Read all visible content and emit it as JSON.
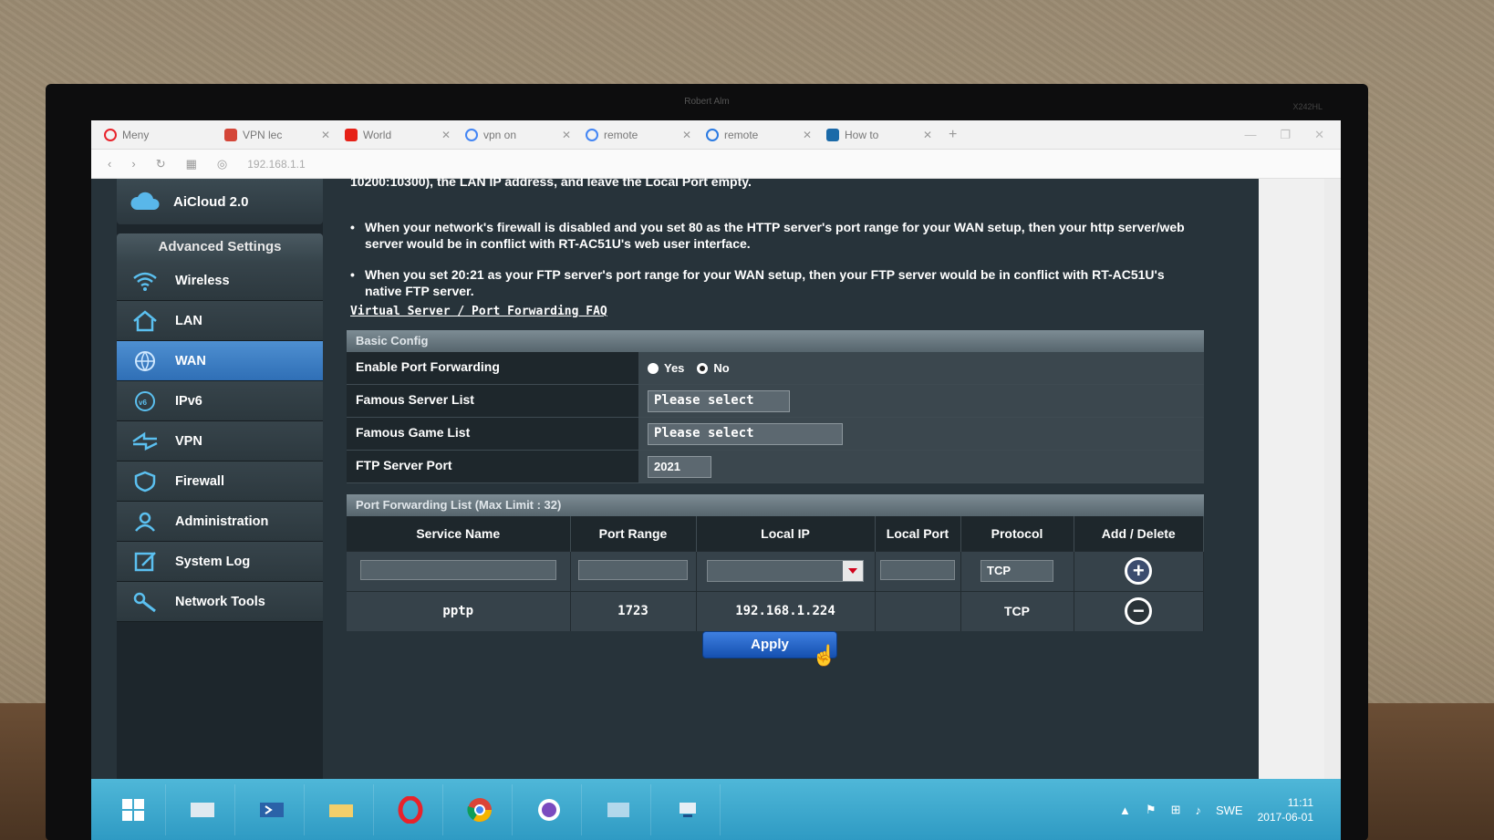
{
  "monitor": {
    "owner_label": "Robert Alm",
    "model_label": "X242HL"
  },
  "browser": {
    "tabs": [
      {
        "label": "Meny",
        "icon": "opera-icon",
        "color": "#e8232b"
      },
      {
        "label": "VPN lec",
        "icon": "gmail-icon",
        "color": "#d44638"
      },
      {
        "label": "World",
        "icon": "youtube-icon",
        "color": "#e62117"
      },
      {
        "label": "vpn on",
        "icon": "google-icon",
        "color": "#4285f4"
      },
      {
        "label": "remote",
        "icon": "google-icon",
        "color": "#4285f4"
      },
      {
        "label": "remote",
        "icon": "search-icon",
        "color": "#2a7ae2"
      },
      {
        "label": "How to",
        "icon": "tm-icon",
        "color": "#1b6aa8"
      }
    ],
    "address": "192.168.1.1"
  },
  "sidebar": {
    "aicloud": "AiCloud 2.0",
    "section_title": "Advanced Settings",
    "items": [
      {
        "label": "Wireless",
        "icon": "wifi-icon",
        "active": false
      },
      {
        "label": "LAN",
        "icon": "home-icon",
        "active": false
      },
      {
        "label": "WAN",
        "icon": "globe-icon",
        "active": true
      },
      {
        "label": "IPv6",
        "icon": "ipv6-icon",
        "active": false
      },
      {
        "label": "VPN",
        "icon": "vpn-icon",
        "active": false
      },
      {
        "label": "Firewall",
        "icon": "shield-icon",
        "active": false
      },
      {
        "label": "Administration",
        "icon": "user-icon",
        "active": false
      },
      {
        "label": "System Log",
        "icon": "log-icon",
        "active": false
      },
      {
        "label": "Network Tools",
        "icon": "tools-icon",
        "active": false
      }
    ]
  },
  "content": {
    "intro": "10200:10300), the LAN IP address, and leave the Local Port empty.",
    "bullet1": "When your network's firewall is disabled and you set 80 as the HTTP server's port range for your WAN setup, then your http server/web server would be in conflict with RT-AC51U's web user interface.",
    "bullet2": "When you set 20:21 as your FTP server's port range for your WAN setup, then your FTP server would be in conflict with RT-AC51U's native FTP server.",
    "faq_link": "Virtual Server / Port Forwarding FAQ",
    "basic_config": {
      "title": "Basic Config",
      "enable_label": "Enable Port Forwarding",
      "yes": "Yes",
      "no": "No",
      "selected": "yes",
      "server_list_label": "Famous Server List",
      "server_list_value": "Please select",
      "game_list_label": "Famous Game List",
      "game_list_value": "Please select",
      "ftp_label": "FTP Server Port",
      "ftp_value": "2021"
    },
    "forward_list": {
      "title": "Port Forwarding List (Max Limit : 32)",
      "columns": [
        "Service Name",
        "Port Range",
        "Local IP",
        "Local Port",
        "Protocol",
        "Add / Delete"
      ],
      "new_row_protocol": "TCP",
      "rows": [
        {
          "service": "pptp",
          "port_range": "1723",
          "local_ip": "192.168.1.224",
          "local_port": "",
          "protocol": "TCP"
        }
      ]
    },
    "apply": "Apply"
  },
  "taskbar": {
    "apps": [
      "windows-start-icon",
      "file-manager-icon",
      "powershell-icon",
      "folder-icon",
      "opera-icon",
      "chrome-icon",
      "messenger-icon",
      "explorer-icon",
      "network-icon"
    ],
    "language": "SWE",
    "time": "11:11",
    "date": "2017-06-01"
  }
}
